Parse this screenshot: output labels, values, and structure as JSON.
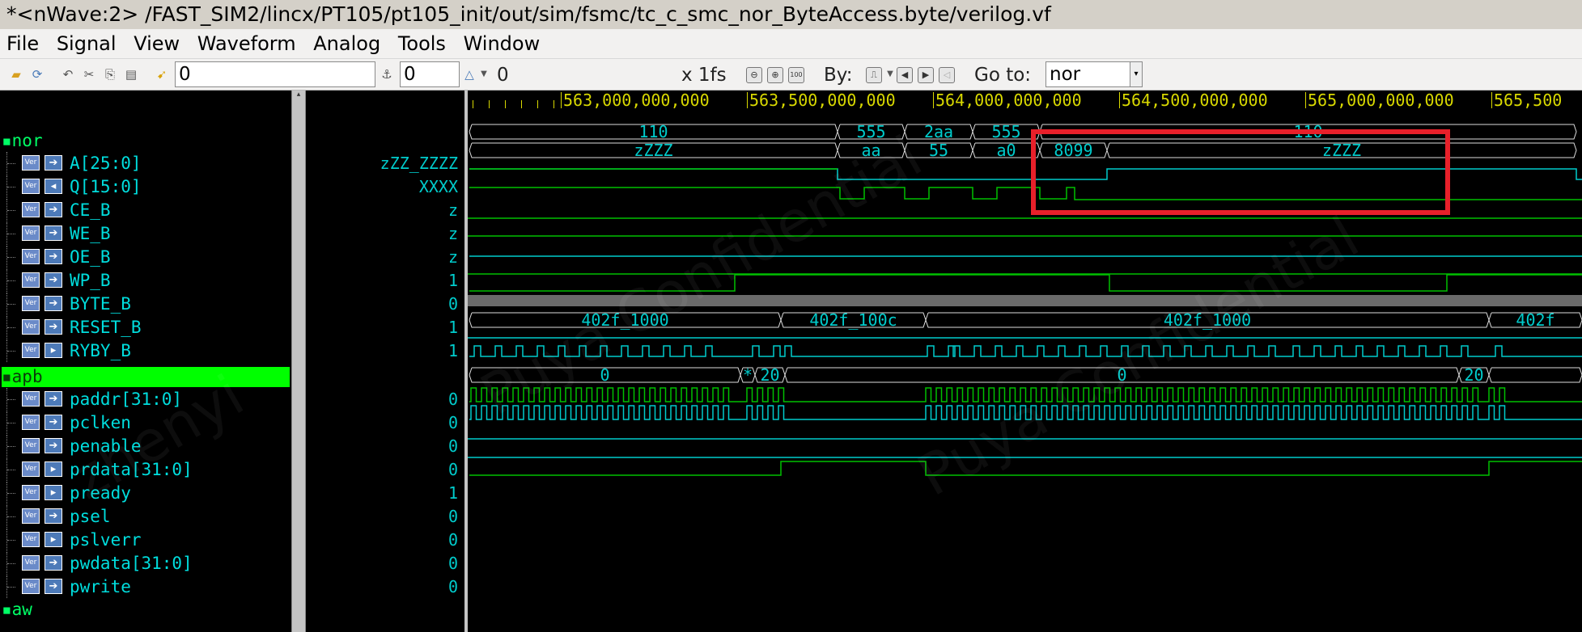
{
  "window": {
    "title": "*<nWave:2> /FAST_SIM2/lincx/PT105/pt105_init/out/sim/fsmc/tc_c_smc_nor_ByteAccess.byte/verilog.vf"
  },
  "menu": [
    "File",
    "Signal",
    "View",
    "Waveform",
    "Analog",
    "Tools",
    "Window"
  ],
  "toolbar": {
    "cursor_time": "0",
    "marker_time": "0",
    "delta_time": "0",
    "time_unit": "x 1fs",
    "by_label": "By:",
    "goto_label": "Go to:",
    "goto_value": "nor"
  },
  "ruler": {
    "ticks": [
      "563,000,000,000",
      "563,500,000,000",
      "564,000,000,000",
      "564,500,000,000",
      "565,000,000,000",
      "565,500"
    ]
  },
  "groups": {
    "nor": "nor",
    "apb": "apb",
    "aw": "aw"
  },
  "signals_nor": [
    {
      "name": "A[25:0]",
      "value": "zZZ_ZZZZ",
      "dir": "in"
    },
    {
      "name": "Q[15:0]",
      "value": "XXXX",
      "dir": "inout"
    },
    {
      "name": "CE_B",
      "value": "z",
      "dir": "in"
    },
    {
      "name": "WE_B",
      "value": "z",
      "dir": "in"
    },
    {
      "name": "OE_B",
      "value": "z",
      "dir": "in"
    },
    {
      "name": "WP_B",
      "value": "1",
      "dir": "in"
    },
    {
      "name": "BYTE_B",
      "value": "0",
      "dir": "in"
    },
    {
      "name": "RESET_B",
      "value": "1",
      "dir": "in"
    },
    {
      "name": "RYBY_B",
      "value": "1",
      "dir": "out"
    }
  ],
  "signals_apb": [
    {
      "name": "paddr[31:0]",
      "value": "0",
      "dir": "in"
    },
    {
      "name": "pclken",
      "value": "0",
      "dir": "in"
    },
    {
      "name": "penable",
      "value": "0",
      "dir": "in"
    },
    {
      "name": "prdata[31:0]",
      "value": "0",
      "dir": "out"
    },
    {
      "name": "pready",
      "value": "1",
      "dir": "out"
    },
    {
      "name": "psel",
      "value": "0",
      "dir": "in"
    },
    {
      "name": "pslverr",
      "value": "0",
      "dir": "out"
    },
    {
      "name": "pwdata[31:0]",
      "value": "0",
      "dir": "in"
    },
    {
      "name": "pwrite",
      "value": "0",
      "dir": "in"
    }
  ],
  "bus_labels": {
    "A": [
      "110",
      "555",
      "2aa",
      "555",
      "110"
    ],
    "Q": [
      "zZZZ",
      "aa",
      "55",
      "a0",
      "8099",
      "zZZZ"
    ],
    "paddr": [
      "402f_1000",
      "402f_100c",
      "402f_1000",
      "402f"
    ],
    "prdata": [
      "0",
      "*",
      "20",
      "0",
      "20"
    ]
  },
  "watermark": [
    "Puya Confidential",
    "Puya Confidential",
    "zhenyi"
  ],
  "colors": {
    "wave": "#00c000",
    "bus": "#00cccc",
    "highlight": "#e8202a",
    "selected_group": "#00ff00",
    "ruler_text": "#d8d800"
  }
}
